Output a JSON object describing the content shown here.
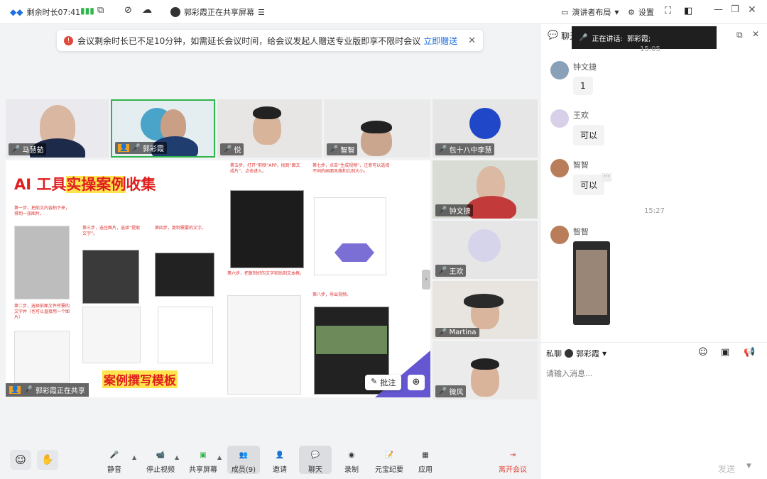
{
  "topbar": {
    "time_left": "剩余时长07:41",
    "sharing": "郭彩霞正在共享屏幕",
    "layout": "演讲者布局",
    "settings": "设置"
  },
  "notice": {
    "text": "会议剩余时长已不足10分钟，如需延长会议时间，给会议发起人赠送专业版即享不限时会议",
    "link": "立即赠送"
  },
  "participants": [
    {
      "name": "马慧茹"
    },
    {
      "name": "郭彩霞"
    },
    {
      "name": "悦"
    },
    {
      "name": "智智"
    },
    {
      "name": "包十八中李慧"
    },
    {
      "name": "钟文捷"
    },
    {
      "name": "王欢"
    },
    {
      "name": "Martina"
    },
    {
      "name": "微风"
    }
  ],
  "share": {
    "title_a": "AI 工具",
    "title_b": "实操案例",
    "title_c": "收集",
    "footer_title": "案例撰写模板",
    "presenter": "郭彩霞正在共享",
    "annotate": "批注",
    "steps": [
      "第一步，把前文内容拍下来，得到一张图片。",
      "第三步，选住图片，选择“提取文字”。",
      "第四步，复制需要的文字。",
      "第五步，打开“剪映”APP，找到“图文成片”，点击进入。",
      "第七步，点击“生成视频”，注意可以选择不同的画面风格和比例大小。",
      "第二步，选择前面文件所需的文字并（也可以直接用一个图片）",
      "第六步，把复制好的文字粘贴到文本框。",
      "第八步，导出视频。"
    ]
  },
  "speaking": {
    "label": "正在讲话:",
    "name": "郭彩霞;"
  },
  "chat": {
    "header": "聊天",
    "time_top": "15:05",
    "messages": [
      {
        "sender": "钟文捷",
        "text": "1"
      },
      {
        "sender": "王欢",
        "text": "可以"
      },
      {
        "sender": "智智",
        "text": "可以"
      }
    ],
    "time_mid": "15:27",
    "img_sender": "智智",
    "private_label": "私聊",
    "private_to": "郭彩霞",
    "placeholder": "请输入消息...",
    "send": "发送"
  },
  "toolbar": {
    "mute": "静音",
    "stop_video": "停止视频",
    "share": "共享屏幕",
    "members": "成员(9)",
    "invite": "邀请",
    "chat": "聊天",
    "record": "录制",
    "ai": "元宝纪要",
    "apps": "应用",
    "leave": "离开会议"
  },
  "colors": {
    "accent": "#1e6fe0",
    "leave": "#e2473a",
    "signal": "#2fb44a",
    "title_red": "#e01e1e",
    "highlight": "#ffe44d"
  }
}
